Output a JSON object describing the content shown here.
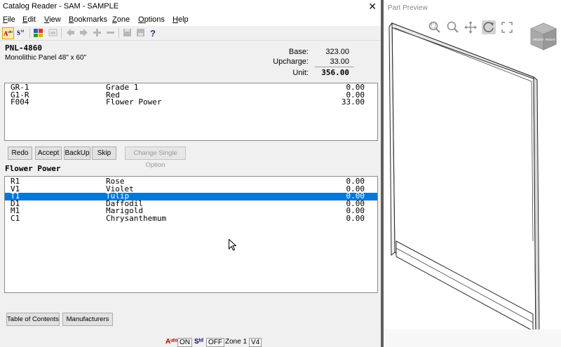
{
  "window": {
    "title": "Catalog Reader - SAM - SAMPLE",
    "close_glyph": "✕"
  },
  "menu": [
    {
      "key": "F",
      "rest": "ile"
    },
    {
      "key": "E",
      "rest": "dit"
    },
    {
      "key": "V",
      "rest": "iew"
    },
    {
      "key": "B",
      "rest": "ookmarks"
    },
    {
      "key": "Z",
      "rest": "one"
    },
    {
      "key": "O",
      "rest": "ptions"
    },
    {
      "key": "H",
      "rest": "elp"
    }
  ],
  "toolbar": {
    "icons": [
      "auto-size-icon",
      "standard-icon",
      "lookup-icon",
      "image-icon",
      "arrow-left-icon",
      "arrow-right-icon",
      "plus-icon",
      "minus-icon",
      "save-icon",
      "save-as-icon",
      "help-icon"
    ]
  },
  "product": {
    "code": "PNL-4860",
    "description": "Monolithic Panel 48\" x 60\"",
    "base_label": "Base:",
    "base_value": "323.00",
    "upcharge_label": "Upcharge:",
    "upcharge_value": "33.00",
    "unit_label": "Unit:",
    "unit_value": "356.00"
  },
  "selected_options": [
    {
      "code": "GR-1",
      "name": "Grade 1",
      "price": "0.00"
    },
    {
      "code": "G1-R",
      "name": "Red",
      "price": "0.00"
    },
    {
      "code": "F004",
      "name": "Flower Power",
      "price": "33.00"
    }
  ],
  "buttons": {
    "redo": "Redo",
    "accept": "Accept",
    "backup": "BackUp",
    "skip": "Skip",
    "change_single": "Change Single Option"
  },
  "current_group": {
    "title": "Flower Power",
    "selected_index": 2,
    "options": [
      {
        "code": "R1",
        "name": "Rose",
        "price": "0.00"
      },
      {
        "code": "V1",
        "name": "Violet",
        "price": "0.00"
      },
      {
        "code": "T1",
        "name": "Tulip",
        "price": "0.00"
      },
      {
        "code": "D1",
        "name": "Daffodil",
        "price": "0.00"
      },
      {
        "code": "M1",
        "name": "Marigold",
        "price": "0.00"
      },
      {
        "code": "C1",
        "name": "Chrysanthemum",
        "price": "0.00"
      }
    ]
  },
  "bottom_buttons": {
    "toc": "Table of Contents",
    "manufacturers": "Manufacturers"
  },
  "status": {
    "auto_label": "Aᵘᵗᵒ",
    "auto_state": "ON",
    "std_label": "Sᵗᵈ",
    "std_state": "OFF",
    "zone": "Zone 1",
    "version": "V4"
  },
  "preview": {
    "title": "Part Preview",
    "cube_label": "FRONT  RIGHT",
    "tools": [
      "zoom-window-icon",
      "zoom-icon",
      "pan-icon",
      "orbit-icon",
      "fit-icon"
    ],
    "active_tool": "orbit-icon"
  },
  "colors": {
    "selection": "#0078d7",
    "toolbar_active": "#fbe9b7"
  }
}
